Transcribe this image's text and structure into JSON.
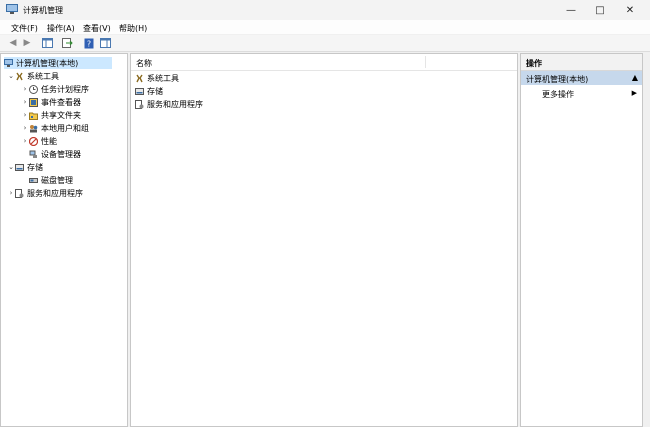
{
  "window": {
    "title": "计算机管理"
  },
  "menu": [
    "文件(F)",
    "操作(A)",
    "查看(V)",
    "帮助(H)"
  ],
  "tree": {
    "root": "计算机管理(本地)",
    "system_tools": "系统工具",
    "task_scheduler": "任务计划程序",
    "event_viewer": "事件查看器",
    "shared_folders": "共享文件夹",
    "local_users": "本地用户和组",
    "performance": "性能",
    "device_manager": "设备管理器",
    "storage": "存储",
    "disk_management": "磁盘管理",
    "services_apps": "服务和应用程序"
  },
  "center": {
    "column_name": "名称",
    "items": [
      "系统工具",
      "存储",
      "服务和应用程序"
    ]
  },
  "actions": {
    "header": "操作",
    "section": "计算机管理(本地)",
    "more": "更多操作"
  },
  "colors": {
    "selection": "#cce8ff",
    "action_section": "#c6d8ec"
  }
}
